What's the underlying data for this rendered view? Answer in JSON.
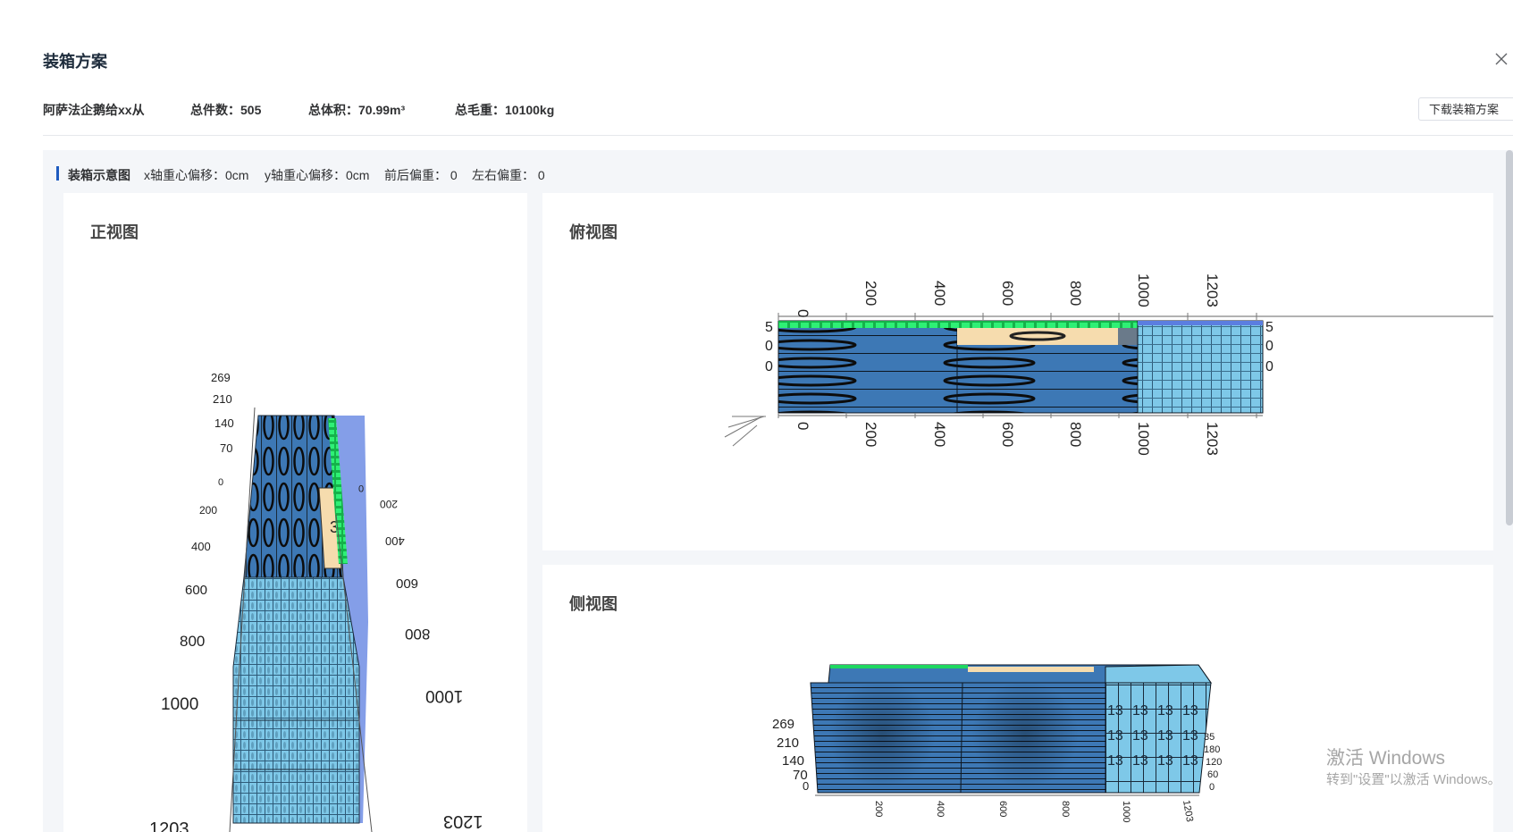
{
  "dialog": {
    "title": "装箱方案"
  },
  "info": {
    "customer": "阿萨法企鹅给xx从",
    "total_count": "总件数：505",
    "total_volume": "总体积：70.99m³",
    "total_weight": "总毛重：10100kg",
    "download_label": "下载装箱方案"
  },
  "diagram": {
    "title": "装箱示意图",
    "x_offset": "x轴重心偏移：0cm",
    "y_offset": "y轴重心偏移：0cm",
    "fb_weight": "前后偏重： 0",
    "lr_weight": "左右偏重： 0"
  },
  "views": {
    "front": {
      "title": "正视图",
      "height_ticks": [
        "269",
        "210",
        "140",
        "70"
      ],
      "length_ticks": [
        "0",
        "200",
        "400",
        "600",
        "800",
        "1000",
        "1203"
      ]
    },
    "top": {
      "title": "俯视图",
      "length_ticks": [
        "0",
        "200",
        "400",
        "600",
        "800",
        "1000",
        "1203"
      ],
      "width_ticks": [
        "5",
        "0",
        "0"
      ]
    },
    "side": {
      "title": "侧视图",
      "height_ticks": [
        "269",
        "210",
        "140",
        "70",
        "0"
      ],
      "width_ticks": [
        "35",
        "180",
        "120",
        "60",
        "0"
      ],
      "length_ticks": [
        "200",
        "400",
        "600",
        "800",
        "1000",
        "1203"
      ],
      "box_label": "13"
    }
  },
  "colors": {
    "pallet_blue": "#3d78b5",
    "carton_lightblue": "#7ec8e8",
    "green_strip": "#1ed760",
    "beige": "#f6dcae",
    "container_edge": "#5b7ee0"
  },
  "icons": {
    "close": "close-icon"
  },
  "watermark": {
    "line1": "激活 Windows",
    "line2": "转到\"设置\"以激活 Windows。"
  }
}
